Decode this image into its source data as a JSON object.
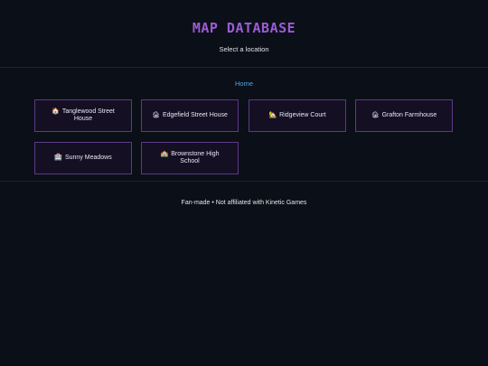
{
  "header": {
    "title": "MAP DATABASE",
    "subtitle": "Select a location"
  },
  "nav": {
    "home": "Home"
  },
  "locations": [
    {
      "icon": "🏠",
      "icon_name": "house-icon",
      "label": "Tanglewood Street House"
    },
    {
      "icon": "🏚",
      "icon_name": "derelict-house-icon",
      "label": "Edgefield Street House"
    },
    {
      "icon": "🏡",
      "icon_name": "house-with-garden-icon",
      "label": "Ridgeview Court"
    },
    {
      "icon": "🏚",
      "icon_name": "derelict-house-icon",
      "label": "Grafton Farmhouse"
    },
    {
      "icon": "🏥",
      "icon_name": "hospital-icon",
      "label": "Sunny Meadows"
    },
    {
      "icon": "🏫",
      "icon_name": "school-icon",
      "label": "Brownstone High School"
    }
  ],
  "footer": {
    "text": "Fan-made • Not affiliated with Kinetic Games"
  },
  "colors": {
    "background": "#0b0f17",
    "title": "#9b5cd6",
    "link": "#4aa8e6",
    "card_border": "#5b3a86",
    "card_background": "#150f24"
  }
}
